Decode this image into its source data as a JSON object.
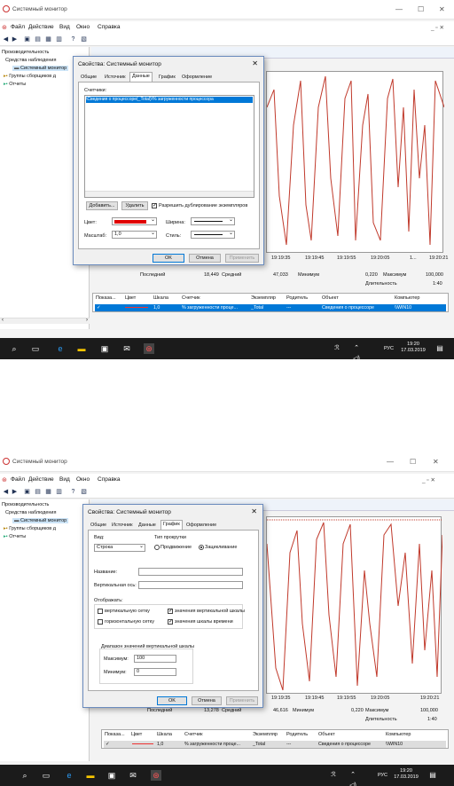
{
  "window_title": "Системный монитор",
  "menu": [
    "Файл",
    "Действие",
    "Вид",
    "Окно",
    "Справка"
  ],
  "tree": {
    "root": "Производительность",
    "monitoring": "Средства наблюдения",
    "sysmon": "Системный монитор",
    "collectors": "Группы сборщиков д",
    "reports": "Отчеты"
  },
  "chart_ticks_x": [
    "19:19:35",
    "19:19:45",
    "19:19:55",
    "19:20:05",
    "1...",
    "19:20:21"
  ],
  "chart_ticks_x_short": [
    "19:19:35",
    "19:19:45",
    "19:19:55",
    "19:20:05",
    "19:20:21"
  ],
  "stats_labels": {
    "last": "Последний",
    "avg": "Средний",
    "min": "Минимум",
    "max": "Максимум",
    "dur": "Длительность"
  },
  "stats1": {
    "last": "18,449",
    "avg": "47,033",
    "min": "0,220",
    "max": "100,000",
    "dur": "1:40"
  },
  "stats2": {
    "last": "13,278",
    "avg": "46,616",
    "min": "0,220",
    "max": "100,000",
    "dur": "1:40"
  },
  "legend": {
    "headers": [
      "Показа...",
      "Цвет",
      "Шкала",
      "Счетчик",
      "Экземпляр",
      "Родитель",
      "Объект",
      "Компьютер"
    ],
    "row": {
      "check": "✓",
      "scale": "1,0",
      "counter": "% загруженности проце...",
      "instance": "_Total",
      "parent": "---",
      "object": "Сведения о процессоре",
      "computer": "\\\\WIN10"
    }
  },
  "dialog": {
    "title": "Свойства: Системный монитор",
    "tabs": [
      "Общие",
      "Источник",
      "Данные",
      "График",
      "Оформление"
    ],
    "ok": "OK",
    "cancel": "Отмена",
    "apply": "Применить"
  },
  "data_tab": {
    "counters_label": "Счетчики:",
    "counter_item": "\\Сведения о процессоре(_Total)\\% загруженности процессора",
    "add": "Добавить...",
    "remove": "Удалить",
    "allow_dup": "Разрешить дублирование экземпляров",
    "color_label": "Цвет:",
    "width_label": "Ширина:",
    "scale_label": "Масштаб:",
    "scale_value": "1,0",
    "style_label": "Стиль:",
    "line_color": "#e00000"
  },
  "graph_tab": {
    "view_label": "Вид:",
    "view_value": "Строка",
    "scroll_label": "Тип прокрутки",
    "scroll_opt1": "Продвижение",
    "scroll_opt2": "Зацикливание",
    "name_label": "Название:",
    "vaxis_label": "Вертикальная ось:",
    "show_label": "Отображать:",
    "vgrid": "вертикальную сетку",
    "hgrid": "горизонтальную сетку",
    "vvalues": "значения вертикальной шкалы",
    "tvalues": "значения шкалы времени",
    "range_label": "Диапазон значений вертикальной шкалы",
    "max_label": "Максимум:",
    "max_value": "100",
    "min_label": "Минимум:",
    "min_value": "0"
  },
  "taskbar": {
    "time": "19:20",
    "date": "17.03.2019",
    "lang": "РУС"
  },
  "colors": {
    "accent": "#0078d7",
    "graph_line": "#c0392b"
  }
}
